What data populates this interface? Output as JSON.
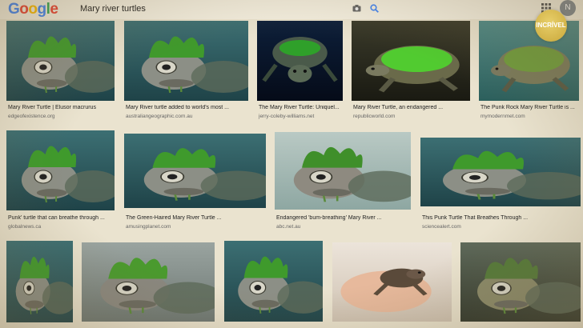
{
  "header": {
    "logo_text": "Google",
    "query": "Mary river turtles",
    "avatar_letter": "N",
    "icons": [
      "camera-icon",
      "search-icon",
      "apps-icon"
    ]
  },
  "badge": {
    "text": "INCRÍVEL"
  },
  "colors": {
    "page_bg": "#eae3cf",
    "link_blue": "#4285f4",
    "turtle_green": "#3a9a2a",
    "water_teal": "#2f5f6a"
  },
  "results": [
    {
      "caption": "Mary River Turtle | Elusor macrurus",
      "source": "edgeofexistence.org"
    },
    {
      "caption": "Mary River turtle added to world's most ...",
      "source": "australiangeographic.com.au"
    },
    {
      "caption": "The Mary River Turtle: Uniquel...",
      "source": "jerry-coleby-williams.net"
    },
    {
      "caption": "Mary River Turtle, an endangered ...",
      "source": "republicworld.com"
    },
    {
      "caption": "The Punk Rock Mary River Turtle is ...",
      "source": "mymodernmet.com"
    },
    {
      "caption": "Punk' turtle that can breathe through ...",
      "source": "globalnews.ca"
    },
    {
      "caption": "The Green-Haired Mary River Turtle ...",
      "source": "amusingplanet.com"
    },
    {
      "caption": "Endangered 'bum-breathing' Mary River ...",
      "source": "abc.net.au"
    },
    {
      "caption": "This Punk Turtle That Breathes Through ...",
      "source": "sciencealert.com"
    },
    {
      "caption": "",
      "source": ""
    },
    {
      "caption": "",
      "source": ""
    },
    {
      "caption": "",
      "source": ""
    },
    {
      "caption": "",
      "source": ""
    },
    {
      "caption": "",
      "source": ""
    }
  ]
}
